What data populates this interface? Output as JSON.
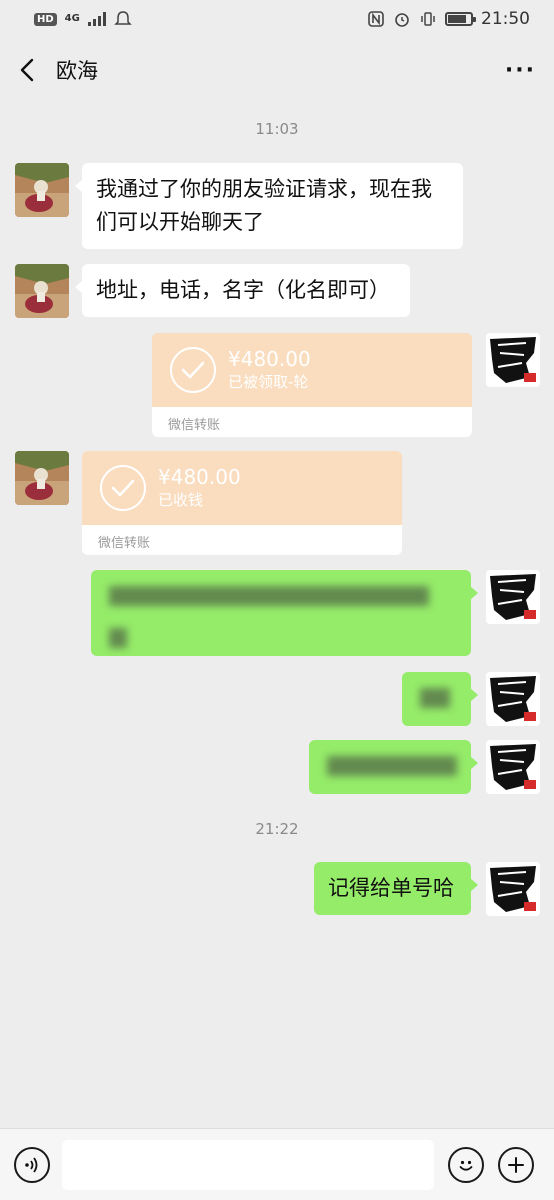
{
  "status_bar": {
    "badge": "HD",
    "network": "4G",
    "time": "21:50"
  },
  "header": {
    "title": "欧海"
  },
  "messages": [
    {
      "type": "time",
      "text": "11:03"
    },
    {
      "type": "text",
      "side": "left",
      "text": "我通过了你的朋友验证请求，现在我们可以开始聊天了"
    },
    {
      "type": "text",
      "side": "left",
      "text": "地址，电话，名字（化名即可）"
    },
    {
      "type": "transfer",
      "side": "right",
      "amount": "¥480.00",
      "status": "已被领取-轮",
      "footer": "微信转账"
    },
    {
      "type": "transfer",
      "side": "left",
      "amount": "¥480.00",
      "status": "已收钱",
      "footer": "微信转账"
    },
    {
      "type": "time",
      "text": "21:22"
    },
    {
      "type": "text",
      "side": "right",
      "text": "记得给单号哈"
    }
  ],
  "input_bar": {
    "placeholder": ""
  },
  "icons": {
    "back": "back-arrow-icon",
    "more": "more-icon",
    "voice": "voice-icon",
    "emoji": "emoji-icon",
    "plus": "plus-icon"
  }
}
